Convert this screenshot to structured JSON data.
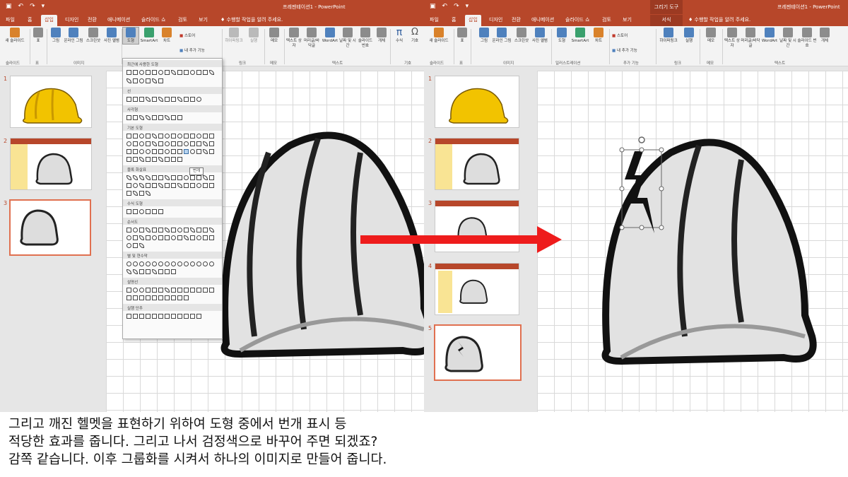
{
  "left": {
    "title": "프레젠테이션1 - PowerPoint",
    "tabs": [
      "파일",
      "홈",
      "삽입",
      "디자인",
      "전환",
      "애니메이션",
      "슬라이드 쇼",
      "검토",
      "보기"
    ],
    "active_tab": "삽입",
    "tell_me": "수행할 작업을 알려 주세요.",
    "ribbon": {
      "new_slide": "새 슬라이드",
      "table": "표",
      "picture": "그림",
      "online_picture": "온라인 그림",
      "screenshot": "스크린샷",
      "photo_album": "사진 앨범",
      "shapes": "도형",
      "smartart": "SmartArt",
      "chart": "차트",
      "store": "스토어",
      "my_addins": "내 추가 기능",
      "hyperlink": "하이퍼링크",
      "action": "실행",
      "comment": "메모",
      "textbox": "텍스트 상자",
      "header_footer": "머리글/바닥글",
      "wordart": "WordArt",
      "date_time": "날짜 및 시간",
      "slide_number": "슬라이드 번호",
      "object": "개체",
      "equation": "수식",
      "symbol": "기호",
      "groups": {
        "slides": "슬라이드",
        "tables": "표",
        "images": "이미지",
        "links": "링크",
        "comments": "메모",
        "text": "텍스트",
        "symbols": "기호"
      }
    },
    "slide_numbers": [
      "1",
      "2",
      "3"
    ],
    "shapes_menu": {
      "categories": [
        "최근에 사용한 도형",
        "선",
        "사각형",
        "기본 도형",
        "블록 화살표",
        "수식 도형",
        "순서도",
        "별 및 현수막",
        "설명선",
        "실행 단추"
      ],
      "tooltip": "번개"
    }
  },
  "right": {
    "title": "프레젠테이션1 - PowerPoint",
    "contextual_group": "그리기 도구",
    "tabs": [
      "파일",
      "홈",
      "삽입",
      "디자인",
      "전환",
      "애니메이션",
      "슬라이드 쇼",
      "검토",
      "보기"
    ],
    "contextual_tab": "서식",
    "active_tab": "삽입",
    "tell_me": "수행할 작업을 알려 주세요.",
    "ribbon": {
      "new_slide": "새 슬라이드",
      "table": "표",
      "picture": "그림",
      "online_picture": "온라인 그림",
      "screenshot": "스크린샷",
      "photo_album": "사진 앨범",
      "shapes": "도형",
      "smartart": "SmartArt",
      "chart": "차트",
      "store": "스토어",
      "my_addins": "내 추가 기능",
      "hyperlink": "하이퍼링크",
      "action": "실행",
      "comment": "메모",
      "textbox": "텍스트 상자",
      "header_footer": "머리글/바닥글",
      "wordart": "WordArt",
      "date_time": "날짜 및 시간",
      "slide_number": "슬라이드 번호",
      "object": "개체",
      "groups": {
        "slides": "슬라이드",
        "tables": "표",
        "images": "이미지",
        "illustrations": "일러스트레이션",
        "addins": "추가 기능",
        "links": "링크",
        "comments": "메모",
        "text": "텍스트"
      }
    },
    "slide_numbers": [
      "1",
      "2",
      "3",
      "4",
      "5"
    ]
  },
  "caption": [
    "그리고 깨진 헬멧을 표현하기 위하여 도형 중에서 번개 표시 등",
    "적당한 효과를 줍니다. 그리고 나서 검정색으로 바꾸어 주면 되겠죠?",
    "감쪽 같습니다. 이후 그룹화를 시켜서 하나의 이미지로 만들어 줍니다."
  ],
  "colors": {
    "accent": "#b7472a",
    "arrow": "#ee1c1c",
    "helmet_yellow": "#f2c300",
    "selection": "#e07050"
  },
  "icons": [
    "save-icon",
    "undo-icon",
    "redo-icon",
    "lightbulb-icon",
    "arrow-right-icon",
    "lightning-bolt-icon"
  ]
}
